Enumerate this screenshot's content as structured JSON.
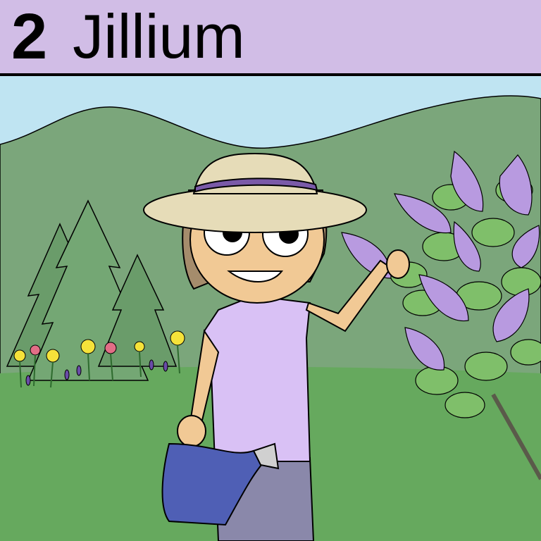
{
  "header": {
    "number": "2",
    "title": "Jillium"
  },
  "colors": {
    "header_bg": "#d1bde6",
    "sky": "#bfe4f2",
    "hills": "#7ba67b",
    "grass": "#66a95e",
    "lilac": "#b89ae0",
    "shirt": "#d9c1f5",
    "skin": "#f1c995"
  }
}
